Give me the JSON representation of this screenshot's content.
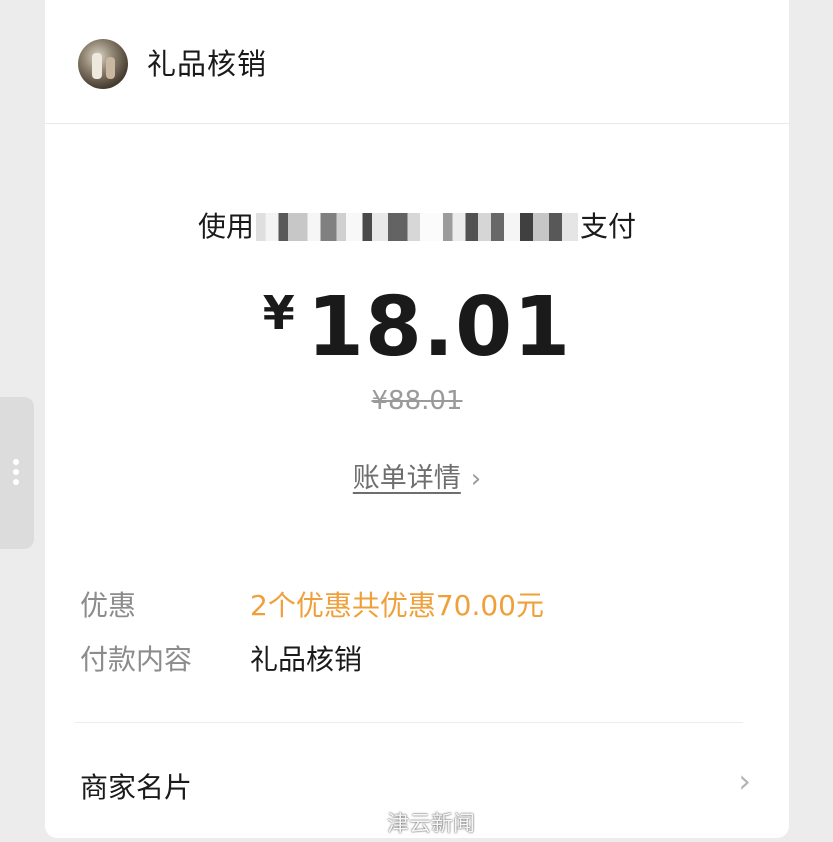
{
  "header": {
    "merchant_name": "礼品核销"
  },
  "payment": {
    "prefix": "使用",
    "suffix": "支付",
    "currency_symbol": "¥",
    "amount": "18.01",
    "original_price": "¥88.01",
    "bill_detail_label": "账单详情",
    "chevron": "›"
  },
  "details": {
    "discount_label": "优惠",
    "discount_value": "2个优惠共优惠70.00元",
    "content_label": "付款内容",
    "content_value": "礼品核销"
  },
  "merchant_card": {
    "label": "商家名片",
    "chevron": "›"
  },
  "watermark": {
    "text": "津云新闻"
  },
  "colors": {
    "discount_orange": "#f0a03a",
    "muted_gray": "#8c8c8c"
  },
  "icons": [
    "avatar",
    "chevron-right-icon",
    "more-vertical-icon",
    "weibo-icon"
  ]
}
